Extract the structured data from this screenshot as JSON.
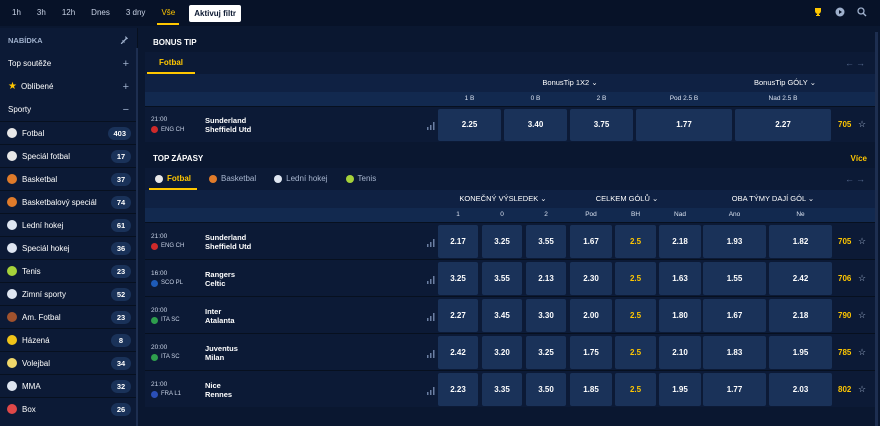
{
  "timefilters": [
    "1h",
    "3h",
    "12h",
    "Dnes",
    "3 dny",
    "Vše"
  ],
  "active_filter": "Vše",
  "filter_button": "Aktivuj filtr",
  "sidebar": {
    "title": "NABÍDKA",
    "sections": [
      {
        "label": "Top soutěže"
      },
      {
        "label": "Oblíbené"
      }
    ],
    "sports_label": "Sporty",
    "sports": [
      {
        "label": "Fotbal",
        "count": "403",
        "icon": "soccer-icon",
        "color": "#e8e8e8"
      },
      {
        "label": "Speciál fotbal",
        "count": "17",
        "icon": "soccer-special-icon",
        "color": "#e8e8e8"
      },
      {
        "label": "Basketbal",
        "count": "37",
        "icon": "basketball-icon",
        "color": "#e07b2a"
      },
      {
        "label": "Basketbalový speciál",
        "count": "74",
        "icon": "basketball-special-icon",
        "color": "#e07b2a"
      },
      {
        "label": "Lední hokej",
        "count": "61",
        "icon": "hockey-icon",
        "color": "#dfe6f1"
      },
      {
        "label": "Speciál hokej",
        "count": "36",
        "icon": "hockey-special-icon",
        "color": "#dfe6f1"
      },
      {
        "label": "Tenis",
        "count": "23",
        "icon": "tennis-icon",
        "color": "#a6d23a"
      },
      {
        "label": "Zimní sporty",
        "count": "52",
        "icon": "skiing-icon",
        "color": "#dfe6f1"
      },
      {
        "label": "Am. Fotbal",
        "count": "23",
        "icon": "american-football-icon",
        "color": "#a0522d"
      },
      {
        "label": "Házená",
        "count": "8",
        "icon": "handball-icon",
        "color": "#f0c419"
      },
      {
        "label": "Volejbal",
        "count": "34",
        "icon": "volleyball-icon",
        "color": "#f0d76a"
      },
      {
        "label": "MMA",
        "count": "32",
        "icon": "mma-icon",
        "color": "#dfe6f1"
      },
      {
        "label": "Box",
        "count": "26",
        "icon": "boxing-icon",
        "color": "#e04848"
      }
    ]
  },
  "bonus": {
    "title": "BONUS TIP",
    "tab": "Fotbal",
    "groups": [
      "BonusTip 1X2",
      "BonusTip GÓLY"
    ],
    "columns": [
      "1 B",
      "0 B",
      "2 B",
      "Pod 2.5 B",
      "Nad 2.5 B"
    ],
    "match": {
      "time": "21:00",
      "league": "ENG CH",
      "home": "Sunderland",
      "away": "Sheffield Utd",
      "odds": [
        "2.25",
        "3.40",
        "3.75",
        "1.77",
        "2.27"
      ],
      "count": "705"
    }
  },
  "top": {
    "title": "TOP ZÁPASY",
    "more": "Více",
    "tabs": [
      {
        "label": "Fotbal",
        "color": "#e8e8e8"
      },
      {
        "label": "Basketbal",
        "color": "#e07b2a"
      },
      {
        "label": "Lední hokej",
        "color": "#dfe6f1"
      },
      {
        "label": "Tenis",
        "color": "#a6d23a"
      }
    ],
    "groups": [
      "KONEČNÝ VÝSLEDEK",
      "CELKEM GÓLŮ",
      "OBA TÝMY DAJÍ GÓL"
    ],
    "columns": [
      "1",
      "0",
      "2",
      "Pod",
      "BH",
      "Nad",
      "Ano",
      "Ne"
    ],
    "matches": [
      {
        "time": "21:00",
        "league": "ENG CH",
        "flag": "#cf2a2a",
        "home": "Sunderland",
        "away": "Sheffield Utd",
        "odds": [
          "2.17",
          "3.25",
          "3.55",
          "1.67",
          "2.5",
          "2.18",
          "1.93",
          "1.82"
        ],
        "count": "705"
      },
      {
        "time": "16:00",
        "league": "SCO PL",
        "flag": "#1e5bb8",
        "home": "Rangers",
        "away": "Celtic",
        "odds": [
          "3.25",
          "3.55",
          "2.13",
          "2.30",
          "2.5",
          "1.63",
          "1.55",
          "2.42"
        ],
        "count": "706"
      },
      {
        "time": "20:00",
        "league": "ITA SC",
        "flag": "#2e9e4d",
        "home": "Inter",
        "away": "Atalanta",
        "odds": [
          "2.27",
          "3.45",
          "3.30",
          "2.00",
          "2.5",
          "1.80",
          "1.67",
          "2.18"
        ],
        "count": "790"
      },
      {
        "time": "20:00",
        "league": "ITA SC",
        "flag": "#2e9e4d",
        "home": "Juventus",
        "away": "Milan",
        "odds": [
          "2.42",
          "3.20",
          "3.25",
          "1.75",
          "2.5",
          "2.10",
          "1.83",
          "1.95"
        ],
        "count": "785"
      },
      {
        "time": "21:00",
        "league": "FRA L1",
        "flag": "#2a4fb8",
        "home": "Nice",
        "away": "Rennes",
        "odds": [
          "2.23",
          "3.35",
          "3.50",
          "1.85",
          "2.5",
          "1.95",
          "1.77",
          "2.03"
        ],
        "count": "802"
      }
    ]
  }
}
